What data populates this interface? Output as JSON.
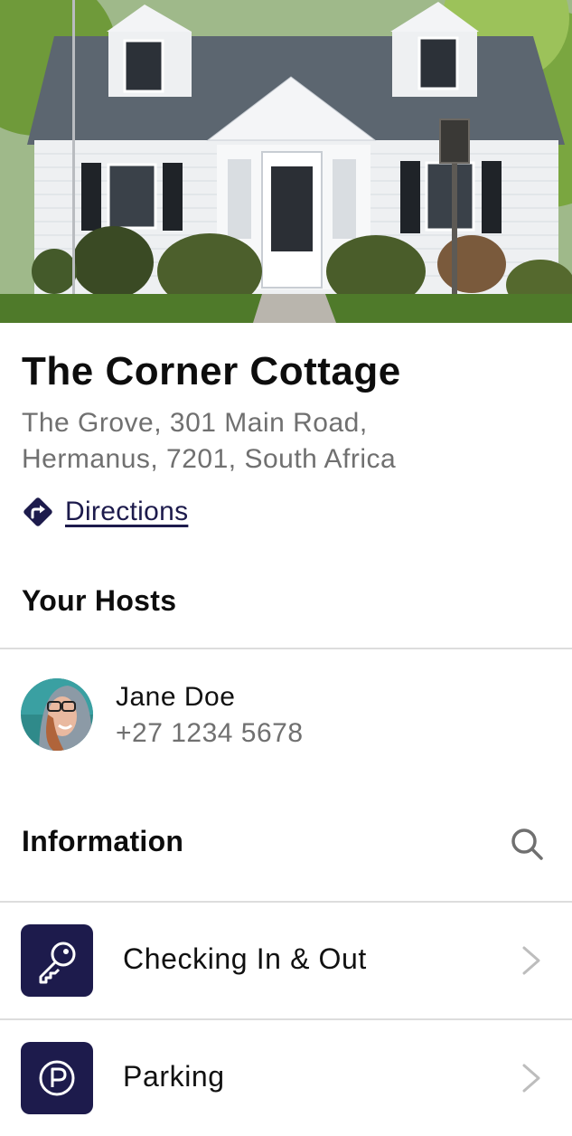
{
  "property": {
    "name": "The Corner Cottage",
    "address_line1": "The Grove, 301 Main Road,",
    "address_line2": "Hermanus, 7201, South Africa",
    "directions_label": "Directions"
  },
  "hosts_section": {
    "title": "Your Hosts",
    "hosts": [
      {
        "name": "Jane Doe",
        "phone": "+27 1234 5678"
      }
    ]
  },
  "info_section": {
    "title": "Information",
    "items": [
      {
        "label": "Checking In & Out",
        "icon": "key-icon"
      },
      {
        "label": "Parking",
        "icon": "parking-icon"
      }
    ]
  },
  "colors": {
    "accent": "#1d1b4c",
    "secondary_text": "#707070",
    "divider": "#dddddd"
  }
}
